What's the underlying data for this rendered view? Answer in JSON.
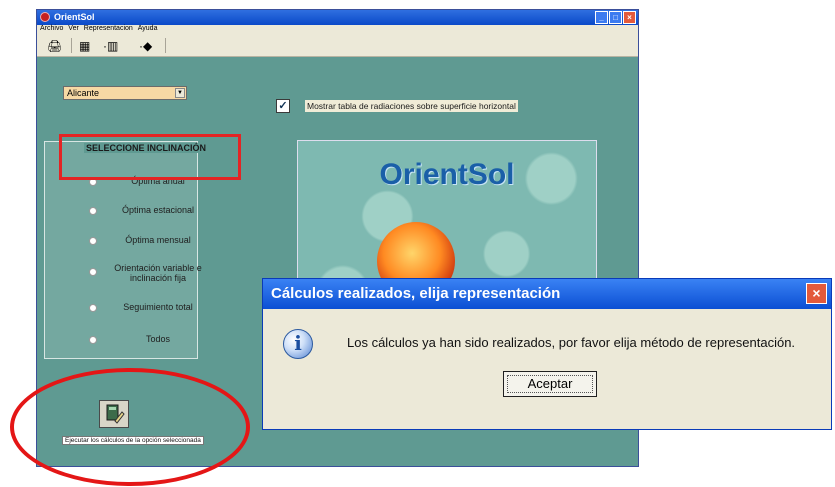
{
  "window": {
    "title": "OrientSol"
  },
  "menu": [
    "Archivo",
    "Ver",
    "Representacion",
    "Ayuda"
  ],
  "location_select": {
    "value": "Alicante"
  },
  "horizontal_checkbox": {
    "checked": true,
    "label": "Mostrar tabla de radiaciones sobre superficie horizontal"
  },
  "inclination_group": {
    "title": "SELECCIONE INCLINACIÓN",
    "options": [
      "Óptima anual",
      "Óptima estacional",
      "Óptima mensual",
      "Orientación variable e inclinación fija",
      "Seguimiento total",
      "Todos"
    ]
  },
  "logo_text": "OrientSol",
  "execute": {
    "label": "Ejecutar los cálculos de la opción seleccionada"
  },
  "dialog": {
    "title": "Cálculos realizados, elija representación",
    "message": "Los cálculos ya han sido realizados, por favor elija método de representación.",
    "ok_label": "Aceptar"
  },
  "colors": {
    "annotation_red": "#e42424",
    "window_bg": "#5f9a92",
    "titlebar_blue": "#0a49c8"
  }
}
